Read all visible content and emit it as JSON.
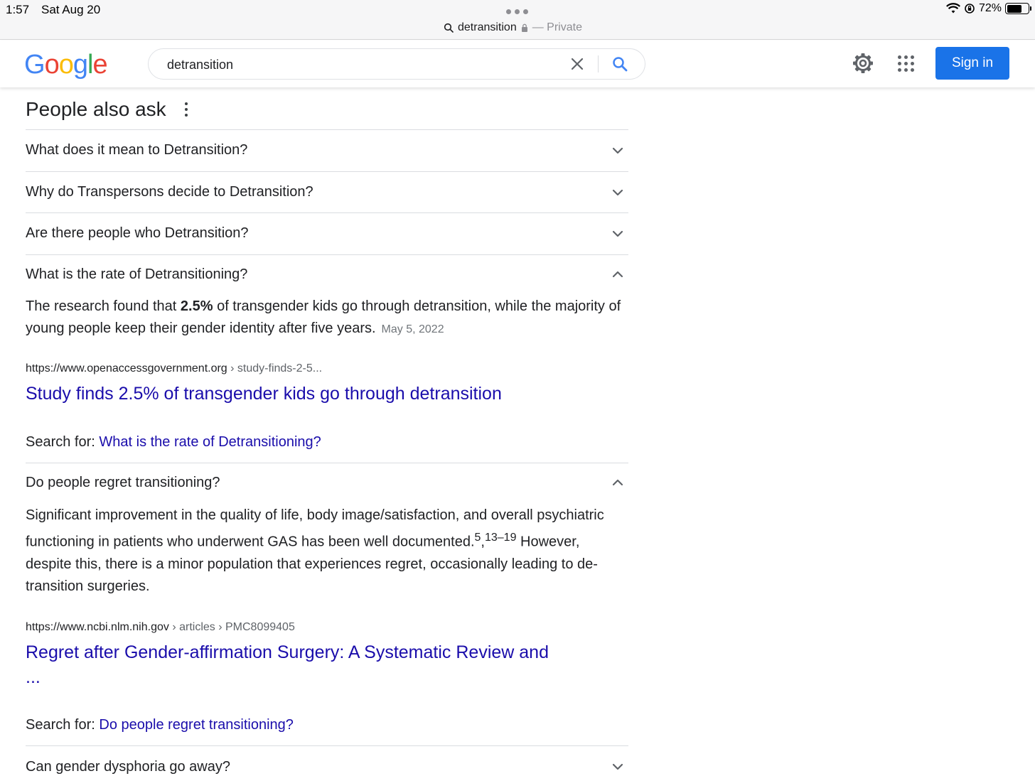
{
  "status_bar": {
    "time": "1:57",
    "date": "Sat Aug 20",
    "url_text": "detransition",
    "private_label": "— Private",
    "battery": "72%",
    "battery_level": 0.72
  },
  "header": {
    "logo_letters": [
      "G",
      "o",
      "o",
      "g",
      "l",
      "e"
    ],
    "logo_colors": [
      "#4285F4",
      "#EA4335",
      "#FBBC05",
      "#4285F4",
      "#34A853",
      "#EA4335"
    ],
    "search_value": "detransition",
    "signin_label": "Sign in",
    "accent": "#1a73e8"
  },
  "paa": {
    "title": "People also ask",
    "questions": [
      {
        "text": "What does it mean to Detransition?",
        "expanded": false
      },
      {
        "text": "Why do Transpersons decide to Detransition?",
        "expanded": false
      },
      {
        "text": "Are there people who Detransition?",
        "expanded": false
      },
      {
        "text": "What is the rate of Detransitioning?",
        "expanded": true
      },
      {
        "text": "Do people regret transitioning?",
        "expanded": true
      },
      {
        "text": "Can gender dysphoria go away?",
        "expanded": false
      }
    ],
    "answer_1": {
      "pre": "The research found that ",
      "bold": "2.5%",
      "post": " of transgender kids go through detransition, while the majority of young people keep their gender identity after five years.",
      "date": "May 5, 2022",
      "cite_domain": "https://www.openaccessgovernment.org",
      "cite_path": " › study-finds-2-5...",
      "link_title": "Study finds 2.5% of transgender kids go through detransition",
      "search_for_label": "Search for: ",
      "search_for_query": "What is the rate of Detransitioning?"
    },
    "answer_2": {
      "text_a": "Significant improvement in the quality of life, body image/satisfaction, and overall psychiatric functioning in patients who underwent GAS has been well documented.",
      "sup_a": "5",
      "comma": ",",
      "sup_b": "13–19",
      "text_b": " However, despite this, there is a minor population that experiences regret, occasionally leading to de-transition surgeries.",
      "cite_domain": "https://www.ncbi.nlm.nih.gov",
      "cite_path": " › articles › PMC8099405",
      "link_title_1": "Regret after Gender-affirmation Surgery: A Systematic Review and",
      "link_title_2": "...",
      "search_for_label": "Search for: ",
      "search_for_query": "Do people regret transitioning?"
    }
  }
}
